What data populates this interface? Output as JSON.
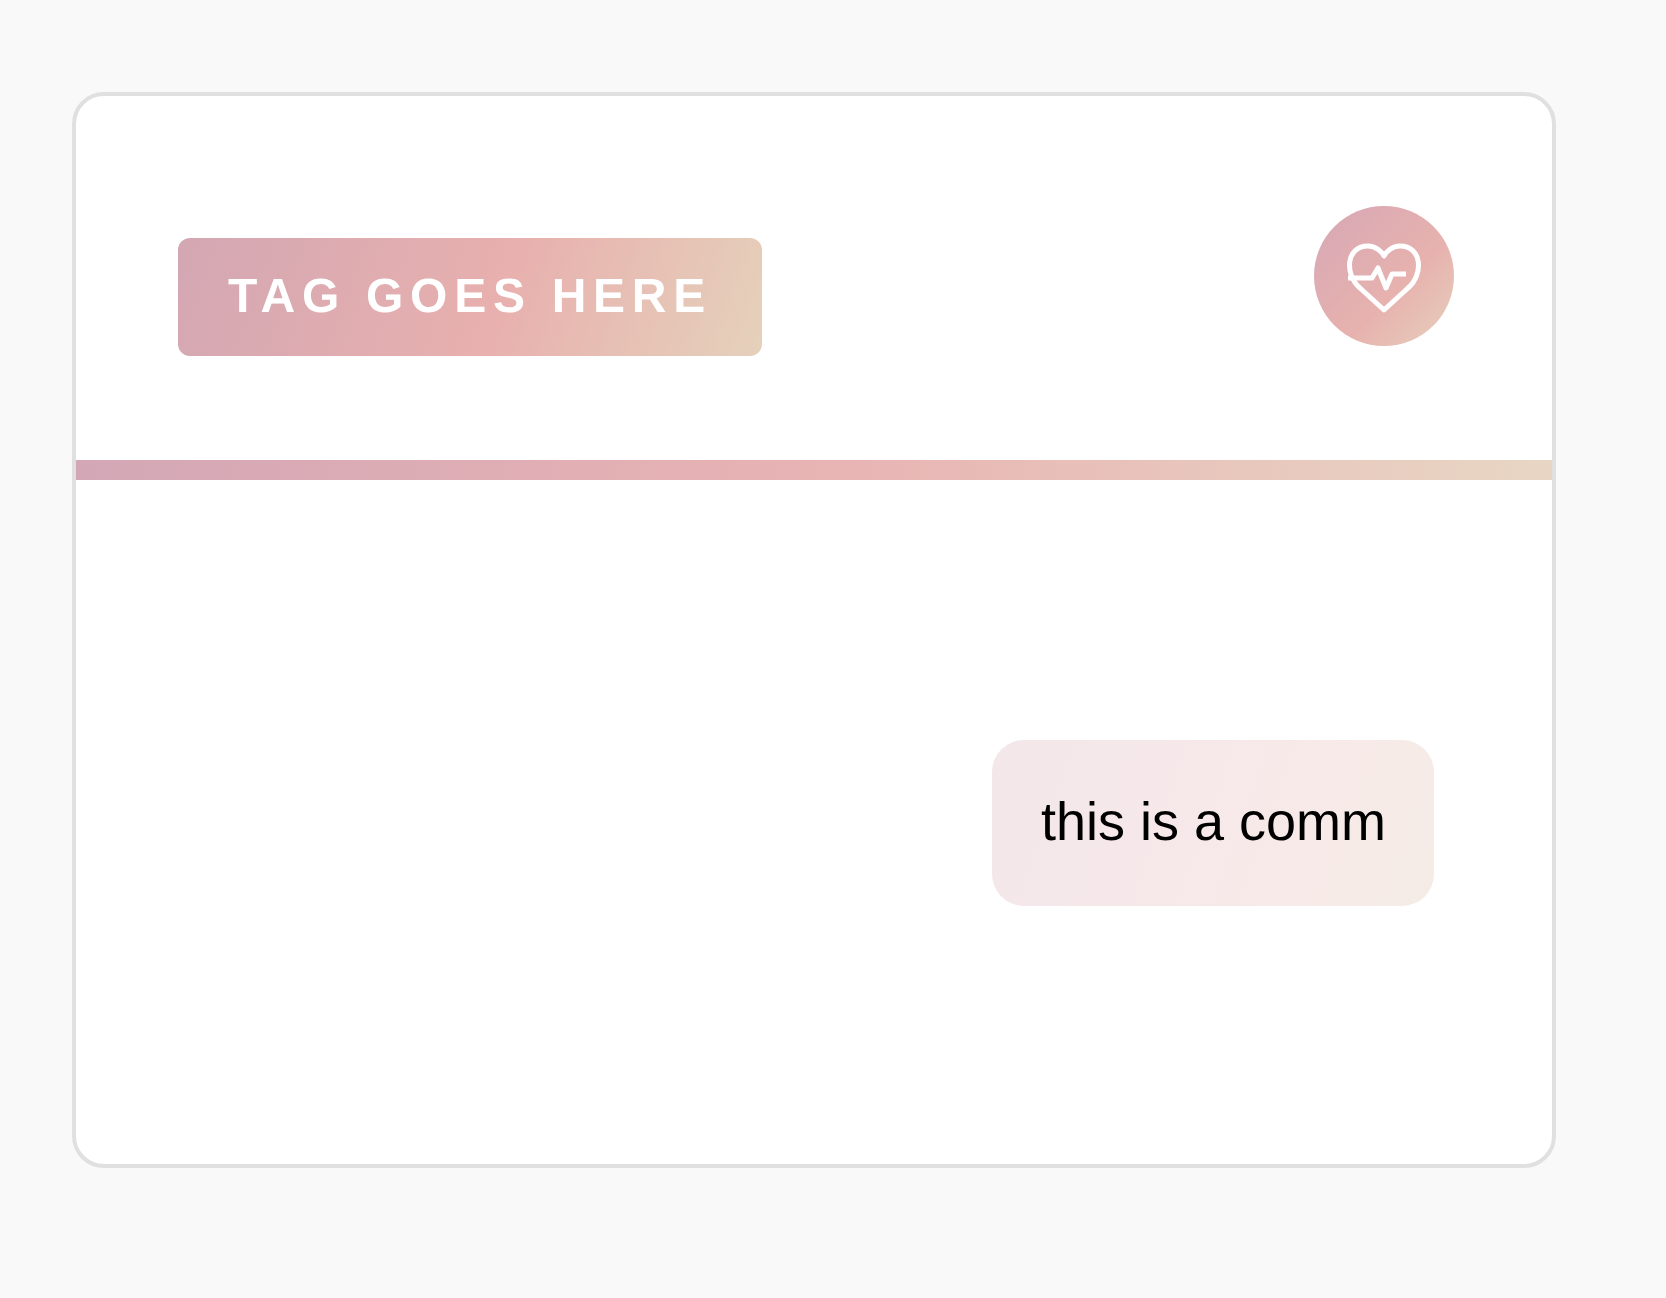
{
  "card": {
    "tag": "TAG GOES HERE",
    "comment": "this is a comm"
  }
}
